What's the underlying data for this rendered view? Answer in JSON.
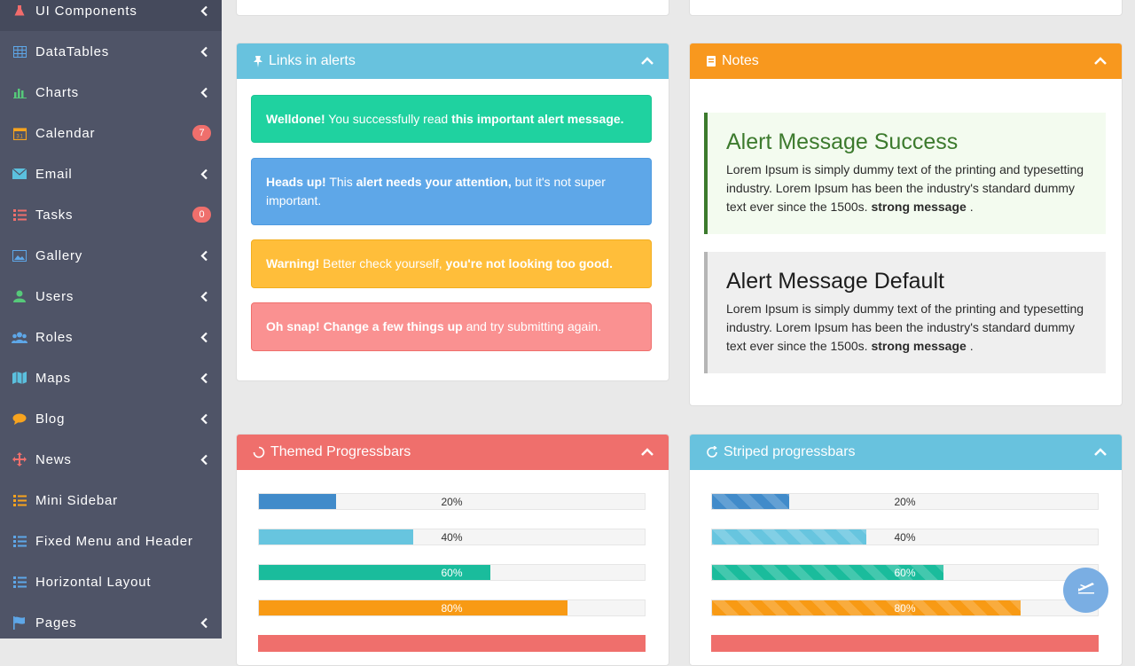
{
  "colors": {
    "sidebar_bg": "#4f5467",
    "info": "#68c2de",
    "warning": "#f8981e",
    "danger": "#ef6f6c",
    "success": "#1fd2a0",
    "primary": "#5ea7e8",
    "alert_warning": "#ffbe3a",
    "alert_danger": "#fa9191",
    "bar_blue": "#418bca",
    "bar_cyan": "#67c5df",
    "bar_green": "#1abc9c",
    "bar_orange": "#f89a14"
  },
  "sidebar": {
    "items": [
      {
        "label": "UI Components",
        "icon": "flask-icon",
        "chevron": true
      },
      {
        "label": "DataTables",
        "icon": "table-icon",
        "chevron": true
      },
      {
        "label": "Charts",
        "icon": "bar-chart-icon",
        "chevron": true
      },
      {
        "label": "Calendar",
        "icon": "calendar-icon",
        "badge": "7"
      },
      {
        "label": "Email",
        "icon": "envelope-icon",
        "chevron": true
      },
      {
        "label": "Tasks",
        "icon": "list-icon",
        "badge": "0"
      },
      {
        "label": "Gallery",
        "icon": "image-icon",
        "chevron": true
      },
      {
        "label": "Users",
        "icon": "user-icon",
        "chevron": true
      },
      {
        "label": "Roles",
        "icon": "users-icon",
        "chevron": true
      },
      {
        "label": "Maps",
        "icon": "map-icon",
        "chevron": true
      },
      {
        "label": "Blog",
        "icon": "comment-icon",
        "chevron": true
      },
      {
        "label": "News",
        "icon": "move-icon",
        "chevron": true
      },
      {
        "label": "Mini Sidebar",
        "icon": "list-icon"
      },
      {
        "label": "Fixed Menu and Header",
        "icon": "list-icon"
      },
      {
        "label": "Horizontal Layout",
        "icon": "list-icon"
      },
      {
        "label": "Pages",
        "icon": "flag-icon",
        "chevron": true
      }
    ]
  },
  "links_panel": {
    "title": "Links in alerts",
    "alerts": [
      {
        "type": "success",
        "parts": [
          {
            "b": true,
            "t": "Welldone!"
          },
          {
            "b": false,
            "t": " You successfully read "
          },
          {
            "b": true,
            "t": "this important alert message."
          }
        ]
      },
      {
        "type": "info",
        "parts": [
          {
            "b": true,
            "t": "Heads up!"
          },
          {
            "b": false,
            "t": " This "
          },
          {
            "b": true,
            "t": "alert needs your attention,"
          },
          {
            "b": false,
            "t": " but it's not super important."
          }
        ]
      },
      {
        "type": "warning",
        "parts": [
          {
            "b": true,
            "t": "Warning!"
          },
          {
            "b": false,
            "t": " Better check yourself, "
          },
          {
            "b": true,
            "t": "you're not looking too good."
          }
        ]
      },
      {
        "type": "danger",
        "parts": [
          {
            "b": true,
            "t": "Oh snap!"
          },
          {
            "b": false,
            "t": " "
          },
          {
            "b": true,
            "t": "Change a few things up"
          },
          {
            "b": false,
            "t": " and try submitting again."
          }
        ]
      }
    ]
  },
  "notes_panel": {
    "title": "Notes",
    "notes": [
      {
        "heading": "Alert Message Success",
        "body": "Lorem Ipsum is simply dummy text of the printing and typesetting industry. Lorem Ipsum has been the industry's standard dummy text ever since the 1500s.",
        "strong": "strong message",
        "tail": " ."
      },
      {
        "heading": "Alert Message Default",
        "body": "Lorem Ipsum is simply dummy text of the printing and typesetting industry. Lorem Ipsum has been the industry's standard dummy text ever since the 1500s.",
        "strong": "strong message",
        "tail": " ."
      }
    ]
  },
  "themed_panel": {
    "title": "Themed Progressbars",
    "bars": [
      {
        "label": "20%",
        "value": 20,
        "color": "#418bca"
      },
      {
        "label": "40%",
        "value": 40,
        "color": "#67c5df"
      },
      {
        "label": "60%",
        "value": 60,
        "color": "#1abc9c"
      },
      {
        "label": "80%",
        "value": 80,
        "color": "#f89a14"
      }
    ]
  },
  "striped_panel": {
    "title": "Striped progressbars",
    "bars": [
      {
        "label": "20%",
        "value": 20,
        "color": "#418bca"
      },
      {
        "label": "40%",
        "value": 40,
        "color": "#67c5df"
      },
      {
        "label": "60%",
        "value": 60,
        "color": "#1abc9c"
      },
      {
        "label": "80%",
        "value": 80,
        "color": "#f89a14"
      }
    ]
  },
  "fab": {
    "icon": "plane-icon"
  }
}
